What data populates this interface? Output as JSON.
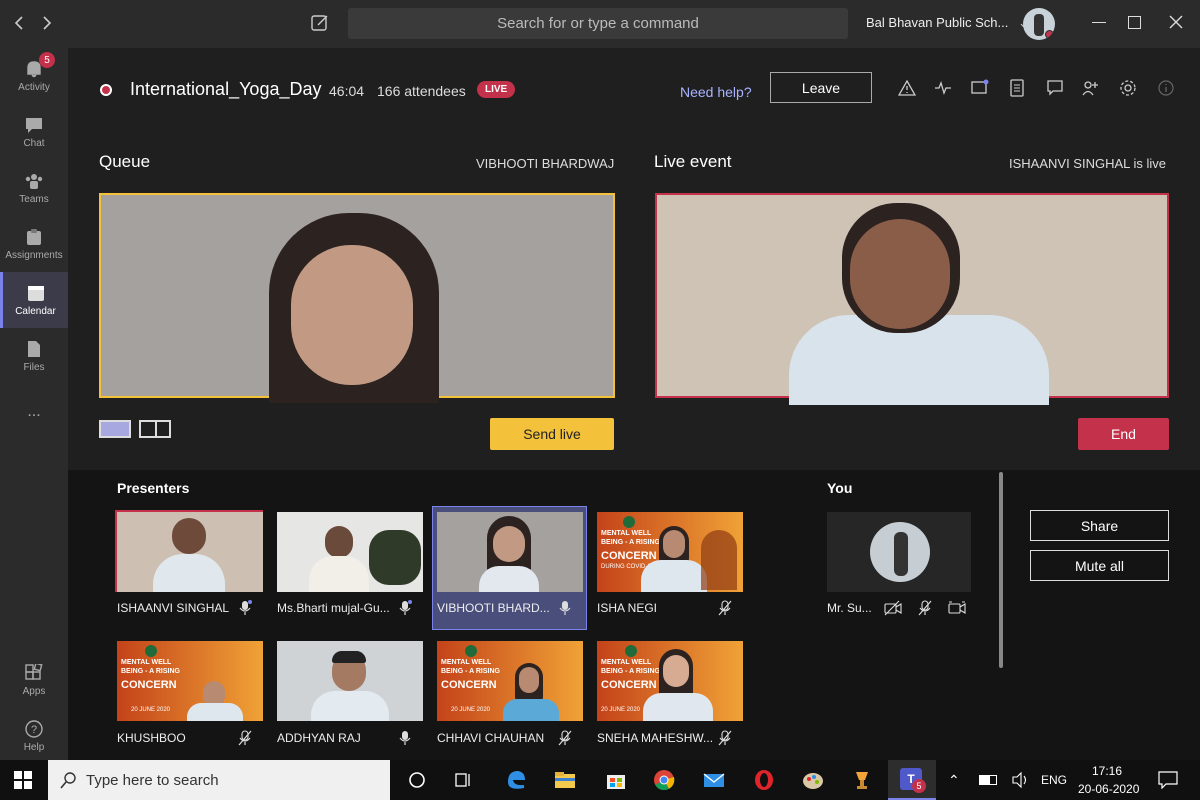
{
  "titlebar": {
    "search_placeholder": "Search for or type a command",
    "org_name": "Bal Bhavan Public Sch...",
    "window_buttons": [
      "minimize-icon",
      "restore-icon",
      "close-icon"
    ]
  },
  "rail": {
    "items": [
      {
        "label": "Activity",
        "badge": "5",
        "icon": "bell-icon"
      },
      {
        "label": "Chat",
        "icon": "chat-icon"
      },
      {
        "label": "Teams",
        "icon": "teams-icon"
      },
      {
        "label": "Assignments",
        "icon": "assignments-icon"
      },
      {
        "label": "Calendar",
        "icon": "calendar-icon",
        "active": true
      },
      {
        "label": "Files",
        "icon": "files-icon"
      },
      {
        "label": "...",
        "icon": "more-icon"
      },
      {
        "label": "Apps",
        "icon": "apps-icon"
      },
      {
        "label": "Help",
        "icon": "help-icon"
      }
    ]
  },
  "meeting": {
    "title": "International_Yoga_Day",
    "duration": "46:04",
    "attendees": "166 attendees",
    "live_badge": "LIVE",
    "need_help": "Need help?",
    "leave_label": "Leave"
  },
  "queue": {
    "label": "Queue",
    "presenter": "VIBHOOTI BHARDWAJ",
    "send_live_label": "Send live"
  },
  "live_event": {
    "label": "Live event",
    "status": "ISHAANVI SINGHAL is live",
    "end_label": "End"
  },
  "presenters": {
    "label": "Presenters",
    "tiles": [
      {
        "name": "ISHAANVI SINGHAL",
        "mic": "on"
      },
      {
        "name": "Ms.Bharti mujal-Gu...",
        "mic": "on"
      },
      {
        "name": "VIBHOOTI BHARD...",
        "mic": "on"
      },
      {
        "name": "ISHA NEGI",
        "mic": "off"
      },
      {
        "name": "KHUSHBOO",
        "mic": "off"
      },
      {
        "name": "ADDHYAN RAJ",
        "mic": "on"
      },
      {
        "name": "CHHAVI CHAUHAN",
        "mic": "off"
      },
      {
        "name": "SNEHA MAHESHW...",
        "mic": "off"
      }
    ]
  },
  "poster": {
    "line1": "MENTAL WELL",
    "line2": "BEING - A RISING",
    "line3": "CONCERN",
    "line4": "DURING COVID-19",
    "date": "20 JUNE 2020"
  },
  "you": {
    "label": "You",
    "name": "Mr. Su...",
    "share_label": "Share",
    "mute_all_label": "Mute all"
  },
  "taskbar": {
    "search_placeholder": "Type here to search",
    "teams_badge": "5",
    "language": "ENG",
    "time": "17:16",
    "date": "20-06-2020"
  },
  "colors": {
    "accent": "#7b83eb",
    "live_red": "#c4314b",
    "queue_yellow": "#f3c13a"
  }
}
